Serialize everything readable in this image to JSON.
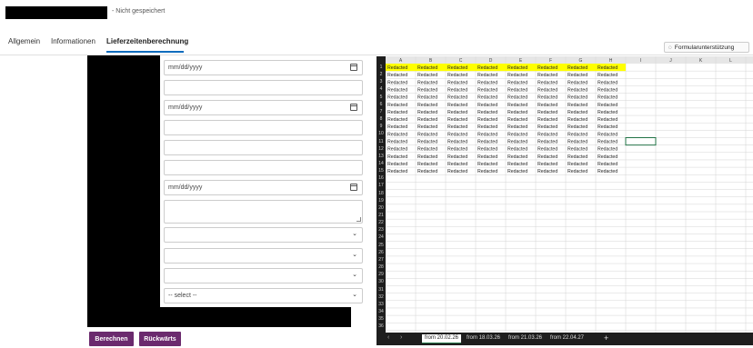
{
  "header": {
    "save_status": "- Nicht gespeichert"
  },
  "tabs": [
    {
      "label": "Allgemein"
    },
    {
      "label": "Informationen"
    },
    {
      "label": "Lieferzeitenberechnung"
    }
  ],
  "form_assist": {
    "label": "Formularunterstützung"
  },
  "form": {
    "date_placeholder": "mm/dd/yyyy",
    "select_placeholder": "-- select --"
  },
  "buttons": {
    "calculate": "Berechnen",
    "back": "Rückwärts"
  },
  "spreadsheet": {
    "columns": [
      "A",
      "B",
      "C",
      "D",
      "E",
      "F",
      "G",
      "H",
      "I",
      "J",
      "K",
      "L"
    ],
    "row_count": 36,
    "filled_rows": 15,
    "filled_cols": 8,
    "cell_text": "Redacted",
    "header_highlight_color": "#ffff00",
    "sheet_tabs": [
      "from 20.02.26",
      "from 18.03.26",
      "from 21.03.26",
      "from 22.04.27"
    ]
  }
}
